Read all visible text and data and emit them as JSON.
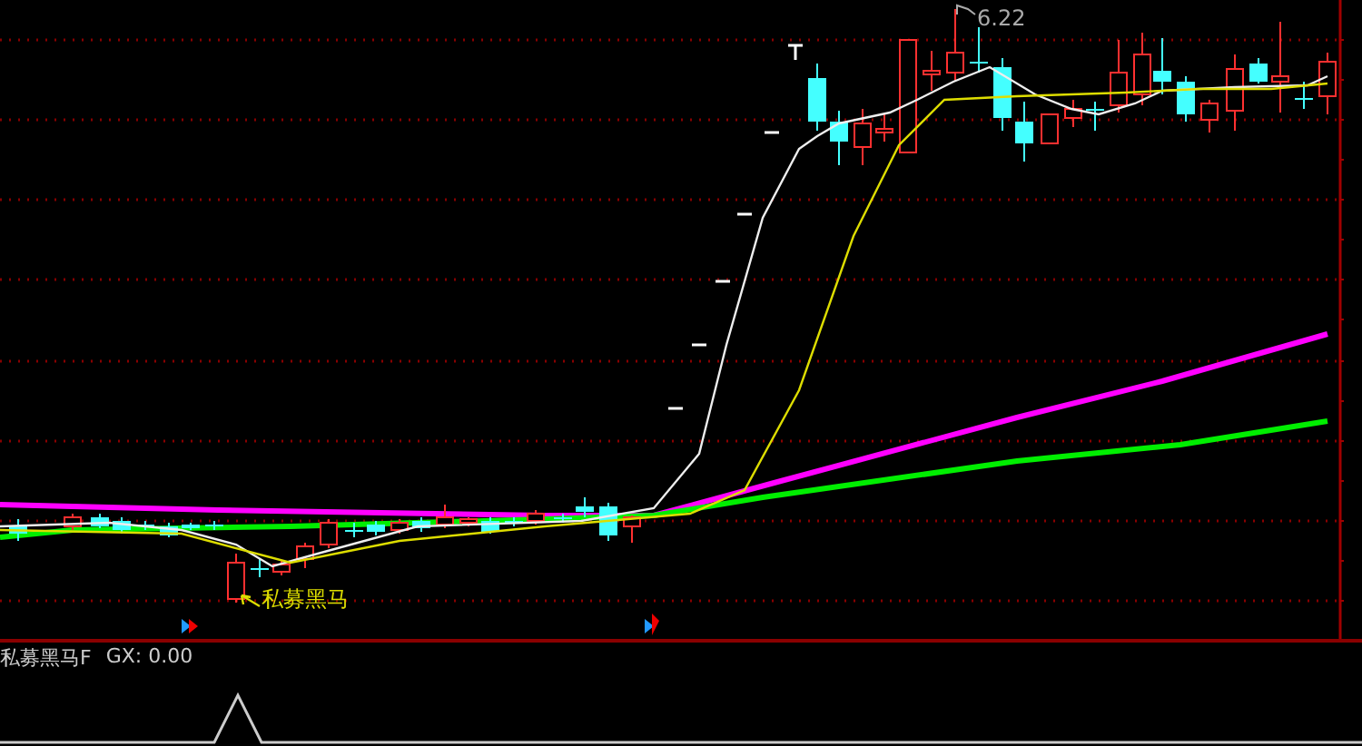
{
  "main_chart": {
    "max_price_label": "6.22",
    "signal_label": "私募黑马"
  },
  "indicator_panel": {
    "title": "私募黑马F",
    "reading": "GX: 0.00"
  }
}
